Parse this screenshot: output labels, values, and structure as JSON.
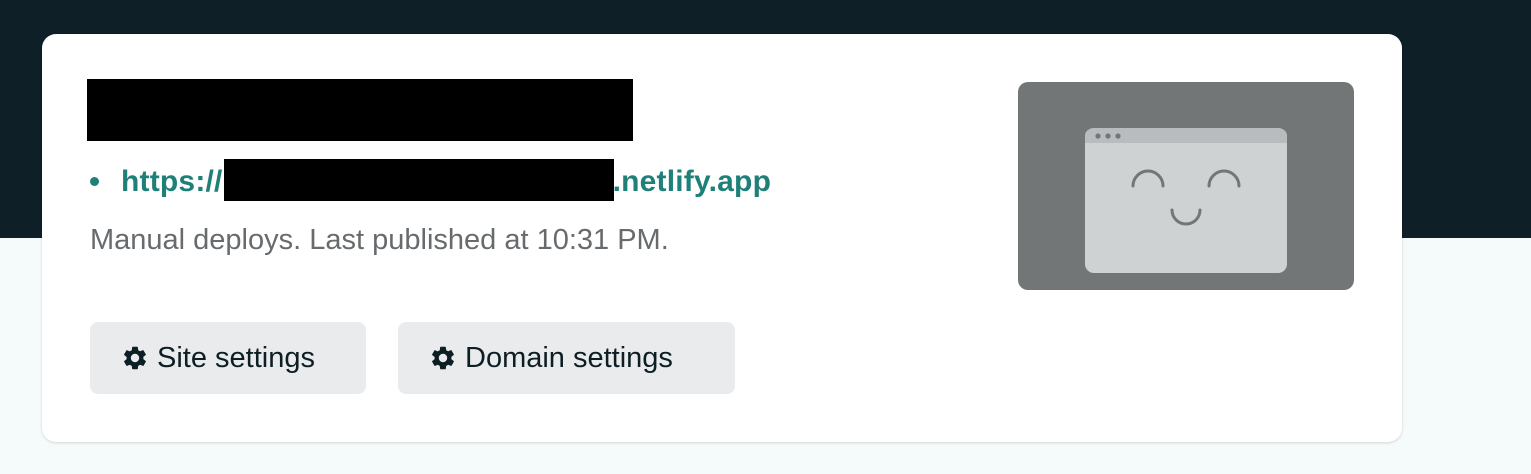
{
  "site": {
    "url_prefix": "https://",
    "url_suffix": ".netlify.app",
    "deploy_status": "Manual deploys. Last published at 10:31 PM."
  },
  "actions": {
    "site_settings_label": "Site settings",
    "domain_settings_label": "Domain settings"
  },
  "icons": {
    "settings": "gear-icon",
    "preview": "browser-smiley-icon"
  },
  "colors": {
    "header_band": "#0f1f27",
    "page_bg": "#f5fbfb",
    "link": "#1f8079",
    "button_bg": "#e9ebed",
    "thumbnail_bg": "#737677"
  }
}
